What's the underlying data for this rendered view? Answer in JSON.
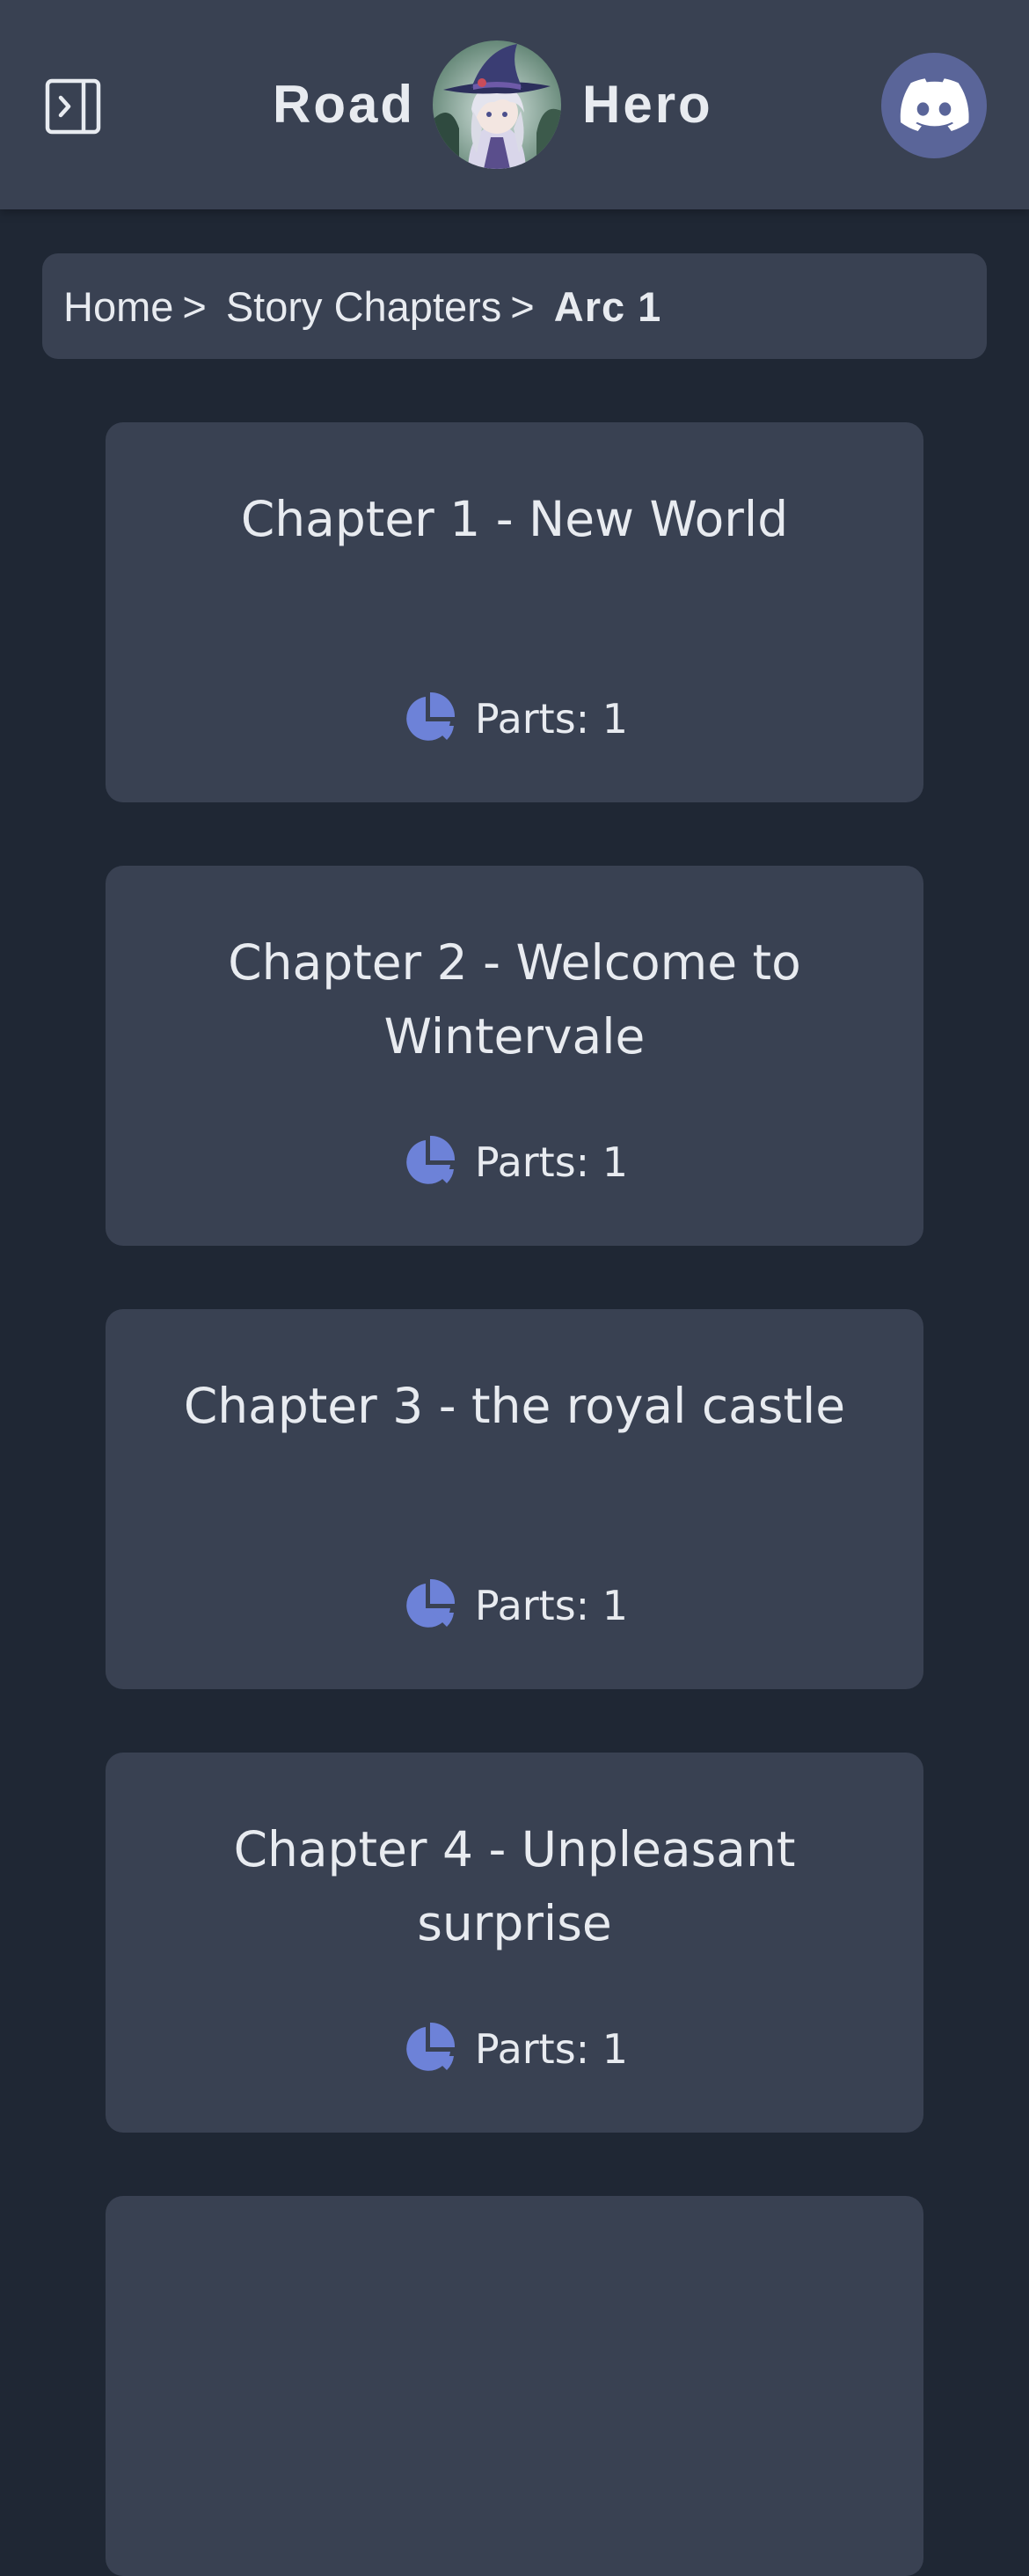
{
  "header": {
    "title_left": "Road",
    "title_right": "Hero"
  },
  "breadcrumb": {
    "home": "Home",
    "sep": ">",
    "story_chapters": "Story Chapters",
    "current": "Arc 1"
  },
  "chapters": [
    {
      "title": "Chapter 1 - New World",
      "parts": "Parts: 1"
    },
    {
      "title": "Chapter 2 - Welcome to Wintervale",
      "parts": "Parts: 1"
    },
    {
      "title": "Chapter 3 - the royal castle",
      "parts": "Parts: 1"
    },
    {
      "title": "Chapter 4 - Unpleasant surprise",
      "parts": "Parts: 1"
    }
  ],
  "colors": {
    "background": "#1f2734",
    "surface": "#394152",
    "accent": "#6d82d8",
    "discord": "#5a6599",
    "text": "#e8ebf0"
  },
  "icons": {
    "sidebar_toggle": "sidebar-expand-icon",
    "discord": "discord-icon",
    "parts": "pie-chart-icon"
  }
}
